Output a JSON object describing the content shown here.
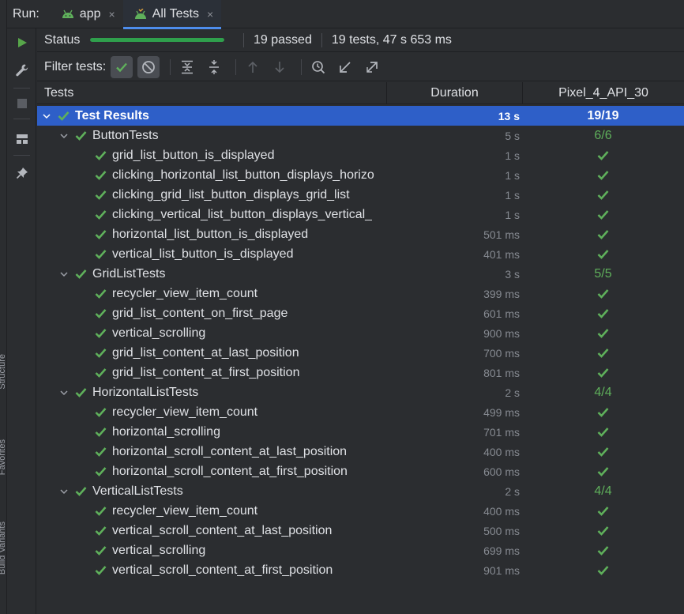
{
  "run": {
    "label": "Run:",
    "tabs": [
      {
        "label": "app",
        "icon": "android-icon",
        "active": false
      },
      {
        "label": "All Tests",
        "icon": "android-test-icon",
        "active": true
      }
    ],
    "close_glyph": "×"
  },
  "side_labels": {
    "structure": "Structure",
    "favorites": "Favorites",
    "build_variants": "Build Variants"
  },
  "status": {
    "label": "Status",
    "progress": 1.0,
    "passed_text": "19 passed",
    "summary_text": "19 tests, 47 s 653 ms"
  },
  "filter": {
    "label": "Filter tests:"
  },
  "table": {
    "headers": {
      "tests": "Tests",
      "duration": "Duration",
      "device": "Pixel_4_API_30"
    },
    "root": {
      "name": "Test Results",
      "duration": "13 s",
      "result": "19/19"
    },
    "groups": [
      {
        "name": "ButtonTests",
        "duration": "5 s",
        "result": "6/6",
        "tests": [
          {
            "name": "grid_list_button_is_displayed",
            "duration": "1 s"
          },
          {
            "name": "clicking_horizontal_list_button_displays_horizo",
            "duration": "1 s"
          },
          {
            "name": "clicking_grid_list_button_displays_grid_list",
            "duration": "1 s"
          },
          {
            "name": "clicking_vertical_list_button_displays_vertical_",
            "duration": "1 s"
          },
          {
            "name": "horizontal_list_button_is_displayed",
            "duration": "501 ms"
          },
          {
            "name": "vertical_list_button_is_displayed",
            "duration": "401 ms"
          }
        ]
      },
      {
        "name": "GridListTests",
        "duration": "3 s",
        "result": "5/5",
        "tests": [
          {
            "name": "recycler_view_item_count",
            "duration": "399 ms"
          },
          {
            "name": "grid_list_content_on_first_page",
            "duration": "601 ms"
          },
          {
            "name": "vertical_scrolling",
            "duration": "900 ms"
          },
          {
            "name": "grid_list_content_at_last_position",
            "duration": "700 ms"
          },
          {
            "name": "grid_list_content_at_first_position",
            "duration": "801 ms"
          }
        ]
      },
      {
        "name": "HorizontalListTests",
        "duration": "2 s",
        "result": "4/4",
        "tests": [
          {
            "name": "recycler_view_item_count",
            "duration": "499 ms"
          },
          {
            "name": "horizontal_scrolling",
            "duration": "701 ms"
          },
          {
            "name": "horizontal_scroll_content_at_last_position",
            "duration": "400 ms"
          },
          {
            "name": "horizontal_scroll_content_at_first_position",
            "duration": "600 ms"
          }
        ]
      },
      {
        "name": "VerticalListTests",
        "duration": "2 s",
        "result": "4/4",
        "tests": [
          {
            "name": "recycler_view_item_count",
            "duration": "400 ms"
          },
          {
            "name": "vertical_scroll_content_at_last_position",
            "duration": "500 ms"
          },
          {
            "name": "vertical_scrolling",
            "duration": "699 ms"
          },
          {
            "name": "vertical_scroll_content_at_first_position",
            "duration": "901 ms"
          }
        ]
      }
    ]
  },
  "colors": {
    "background": "#2b2d30",
    "selection": "#2e5fc8",
    "pass_green": "#5fb05b",
    "progress_green": "#2f9f4c",
    "accent_blue": "#4d8ded"
  }
}
